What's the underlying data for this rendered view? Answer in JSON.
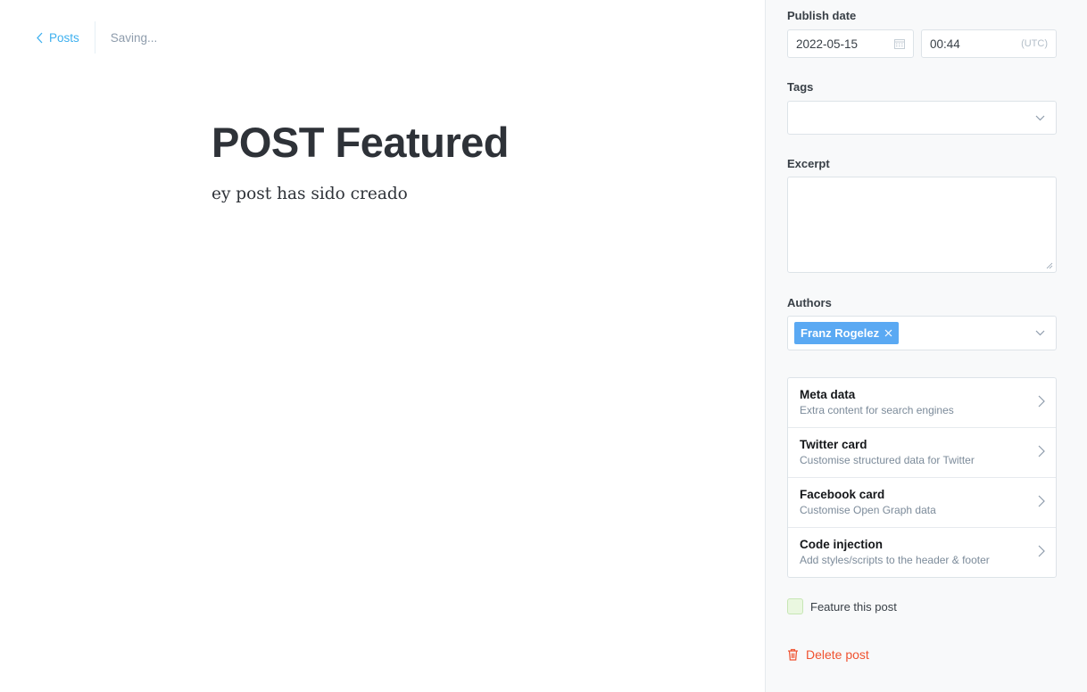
{
  "header": {
    "back_label": "Posts",
    "status": "Saving..."
  },
  "post": {
    "title": "POST Featured",
    "body": "ey post has sido creado"
  },
  "settings": {
    "publish_date": {
      "label": "Publish date",
      "date": "2022-05-15",
      "time": "00:44",
      "timezone": "(UTC)"
    },
    "tags": {
      "label": "Tags",
      "value": ""
    },
    "excerpt": {
      "label": "Excerpt",
      "value": ""
    },
    "authors": {
      "label": "Authors",
      "selected": [
        "Franz Rogelez"
      ]
    },
    "sections": [
      {
        "title": "Meta data",
        "description": "Extra content for search engines"
      },
      {
        "title": "Twitter card",
        "description": "Customise structured data for Twitter"
      },
      {
        "title": "Facebook card",
        "description": "Customise Open Graph data"
      },
      {
        "title": "Code injection",
        "description": "Add styles/scripts to the header & footer"
      }
    ],
    "feature": {
      "label": "Feature this post",
      "checked": false
    },
    "delete_label": "Delete post"
  },
  "colors": {
    "accent": "#3eb0ef",
    "author_token": "#5aa9f3",
    "danger": "#f05230",
    "sidebar_bg": "#f8f9fa"
  }
}
